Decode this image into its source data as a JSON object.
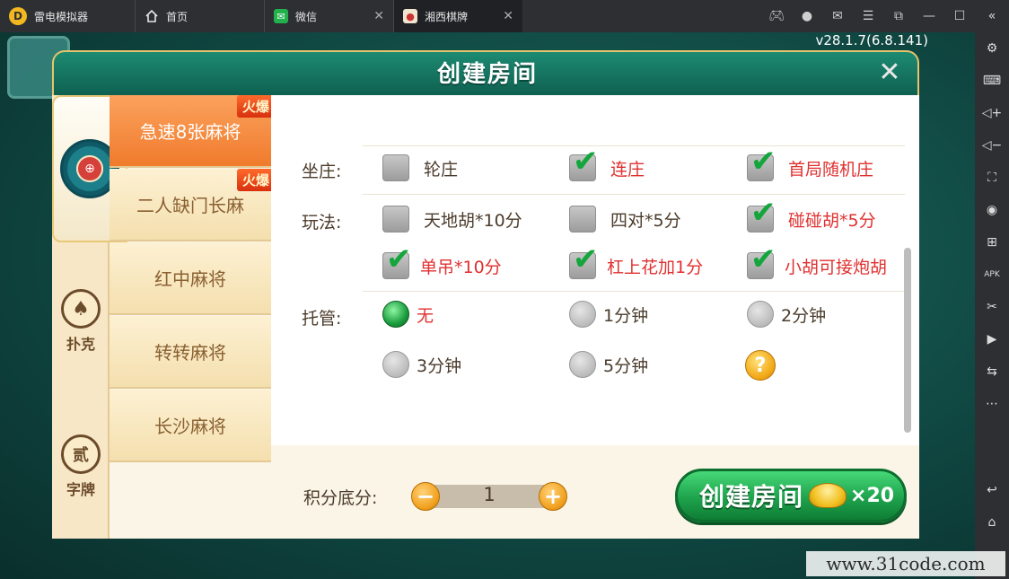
{
  "window": {
    "app_name": "雷电模拟器",
    "tabs": [
      {
        "label": "首页",
        "icon": "home-icon"
      },
      {
        "label": "微信",
        "icon": "wechat-icon"
      },
      {
        "label": "湘西棋牌",
        "icon": "game-icon"
      }
    ],
    "controls": [
      "gamepad-icon",
      "user-icon",
      "mail-icon",
      "menu-icon",
      "restore-icon",
      "minimize-icon",
      "maximize-icon",
      "close-icon"
    ]
  },
  "sidebar": {
    "items": [
      "collapse-icon",
      "settings-icon",
      "keyboard-icon",
      "volume-up-icon",
      "volume-down-icon",
      "screenshot-icon",
      "record-icon",
      "install-icon",
      "apk-icon",
      "scissors-icon",
      "video-icon",
      "sync-icon",
      "more-icon",
      "back-icon",
      "home-icon"
    ]
  },
  "game": {
    "version": "v28.1.7(6.8.141)"
  },
  "dialog": {
    "title": "创建房间",
    "categories": [
      {
        "label": "扑克",
        "glyph": "♠"
      },
      {
        "label": "字牌",
        "glyph": "贰"
      }
    ],
    "modes": [
      {
        "label": "急速8张麻将",
        "hot": "火爆",
        "active": true
      },
      {
        "label": "二人缺门长麻",
        "hot": "火爆",
        "active": false
      },
      {
        "label": "红中麻将",
        "hot": "",
        "active": false
      },
      {
        "label": "转转麻将",
        "hot": "",
        "active": false
      },
      {
        "label": "长沙麻将",
        "hot": "",
        "active": false
      }
    ],
    "rows": {
      "banker_label": "坐庄:",
      "play_label": "玩法:",
      "auto_label": "托管:"
    },
    "banker_options": [
      {
        "label": "轮庄",
        "checked": false
      },
      {
        "label": "连庄",
        "checked": true
      },
      {
        "label": "首局随机庄",
        "checked": true
      }
    ],
    "play_options": [
      {
        "label": "天地胡*10分",
        "checked": false
      },
      {
        "label": "四对*5分",
        "checked": false
      },
      {
        "label": "碰碰胡*5分",
        "checked": true
      },
      {
        "label": "单吊*10分",
        "checked": true
      },
      {
        "label": "杠上花加1分",
        "checked": true
      },
      {
        "label": "小胡可接炮胡",
        "checked": true
      }
    ],
    "auto_options": [
      {
        "label": "无",
        "selected": true
      },
      {
        "label": "1分钟",
        "selected": false
      },
      {
        "label": "2分钟",
        "selected": false
      },
      {
        "label": "3分钟",
        "selected": false
      },
      {
        "label": "5分钟",
        "selected": false
      }
    ],
    "help_glyph": "?",
    "score": {
      "label": "积分底分:",
      "value": "1",
      "minus": "−",
      "plus": "+"
    },
    "create_button": {
      "label": "创建房间",
      "cost": "×20"
    }
  },
  "watermark": "www.31code.com",
  "colors": {
    "accent_orange": "#f07b2d",
    "check_green": "#14a53c",
    "red_text": "#e03030"
  }
}
